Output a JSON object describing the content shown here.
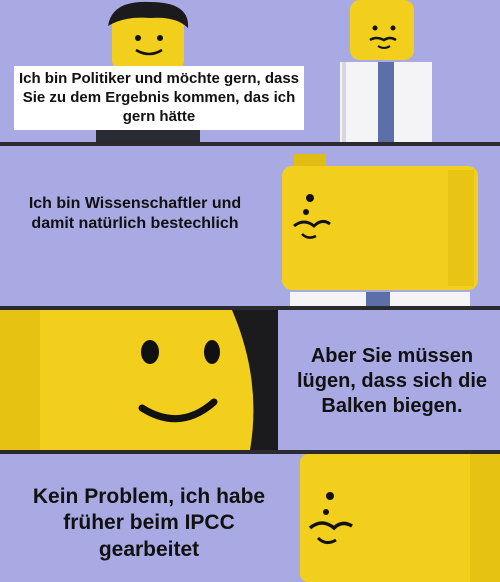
{
  "panels": [
    {
      "caption": "Ich bin Politiker und möchte gern, dass Sie zu dem Ergebnis kommen, das ich gern hätte"
    },
    {
      "caption": "Ich bin Wissenschaftler und damit natürlich bestechlich"
    },
    {
      "caption": "Aber Sie müssen lügen, dass sich die Balken biegen."
    },
    {
      "caption": "Kein Problem, ich habe früher beim IPCC gearbeitet"
    }
  ],
  "colors": {
    "background": "#a7a8e2",
    "lego_yellow": "#f2cf1c",
    "hair": "#1b1b1e",
    "caption_box": "#ffffff"
  }
}
